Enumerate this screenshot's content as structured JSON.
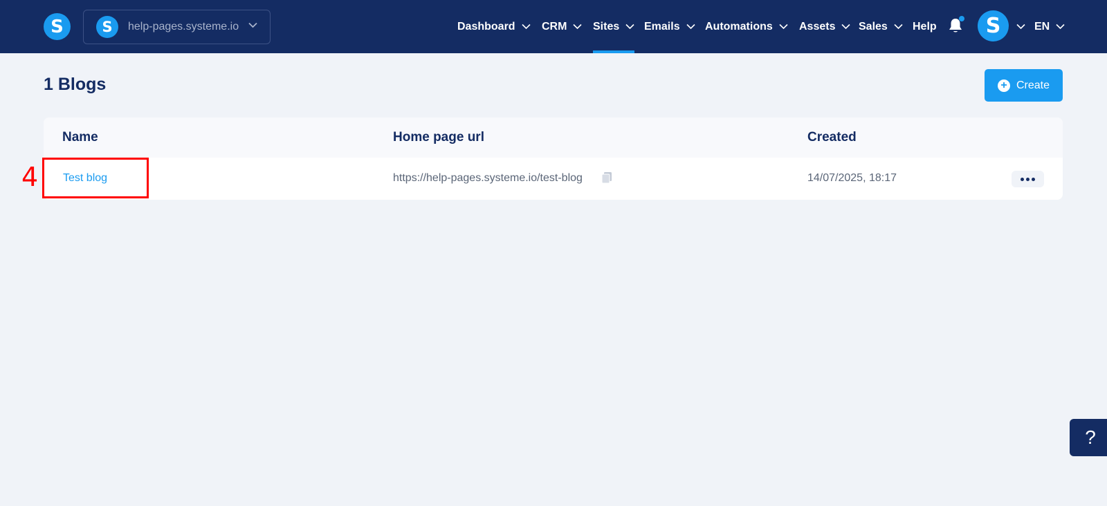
{
  "header": {
    "logo_letter": "S",
    "site_switcher": {
      "logo_letter": "S",
      "name": "help-pages.systeme.io"
    },
    "nav": [
      {
        "label": "Dashboard",
        "has_dropdown": true
      },
      {
        "label": "CRM",
        "has_dropdown": true
      },
      {
        "label": "Sites",
        "has_dropdown": true,
        "active": true
      },
      {
        "label": "Emails",
        "has_dropdown": true
      },
      {
        "label": "Automations",
        "has_dropdown": true
      },
      {
        "label": "Assets",
        "has_dropdown": true
      },
      {
        "label": "Sales",
        "has_dropdown": true
      },
      {
        "label": "Help",
        "has_dropdown": false
      }
    ],
    "avatar_letter": "S",
    "language": "EN"
  },
  "page": {
    "title": "1 Blogs",
    "create_label": "Create"
  },
  "table": {
    "columns": [
      "Name",
      "Home page url",
      "Created"
    ],
    "rows": [
      {
        "name": "Test blog",
        "url": "https://help-pages.systeme.io/test-blog",
        "created": "14/07/2025, 18:17"
      }
    ]
  },
  "annotation": {
    "number": "4"
  },
  "help_button": "?",
  "colors": {
    "navy": "#142c63",
    "accent": "#1a9bf0",
    "annotation": "#ff0000"
  }
}
